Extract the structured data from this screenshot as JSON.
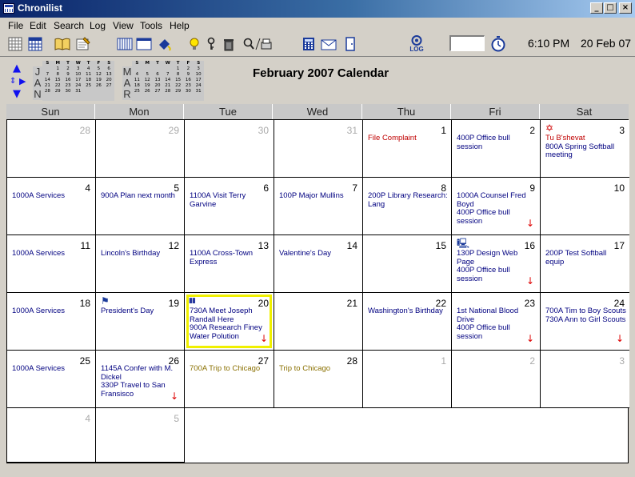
{
  "window": {
    "title": "Chronilist",
    "min_glyph": "_",
    "max_glyph": "□",
    "close_glyph": "×"
  },
  "menu": [
    "File",
    "Edit",
    "Search",
    "Log",
    "View",
    "Tools",
    "Help"
  ],
  "toolbar": {
    "time": "6:10 PM",
    "date": "20 Feb 07",
    "log_label": "LOG",
    "icons": [
      "year-view-icon",
      "month-view-icon",
      "book-icon",
      "notes-icon",
      "week-view-icon",
      "day-view-icon",
      "paint-icon",
      "idea-bulb-icon",
      "key-icon",
      "trash-icon",
      "find-print-icon",
      "calculator-icon",
      "mail-icon",
      "door-icon",
      "log-icon",
      "stopwatch-icon"
    ]
  },
  "nav": {
    "title": "February 2007 Calendar",
    "mini_prev": {
      "letters": [
        "J",
        "A",
        "N"
      ],
      "header": [
        "S",
        "M",
        "T",
        "W",
        "T",
        "F",
        "S"
      ],
      "days": [
        "",
        "1",
        "2",
        "3",
        "4",
        "5",
        "6",
        "7",
        "8",
        "9",
        "10",
        "11",
        "12",
        "13",
        "14",
        "15",
        "16",
        "17",
        "18",
        "19",
        "20",
        "21",
        "22",
        "23",
        "24",
        "25",
        "26",
        "27",
        "28",
        "29",
        "30",
        "31"
      ]
    },
    "mini_next": {
      "letters": [
        "M",
        "A",
        "R"
      ],
      "header": [
        "S",
        "M",
        "T",
        "W",
        "T",
        "F",
        "S"
      ],
      "days": [
        "",
        "",
        "",
        "",
        "1",
        "2",
        "3",
        "4",
        "5",
        "6",
        "7",
        "8",
        "9",
        "10",
        "11",
        "12",
        "13",
        "14",
        "15",
        "16",
        "17",
        "18",
        "19",
        "20",
        "21",
        "22",
        "23",
        "24",
        "25",
        "26",
        "27",
        "28",
        "29",
        "30",
        "31"
      ]
    }
  },
  "day_names": [
    "Sun",
    "Mon",
    "Tue",
    "Wed",
    "Thu",
    "Fri",
    "Sat"
  ],
  "weeks": [
    [
      {
        "num": "28",
        "other": true,
        "events": []
      },
      {
        "num": "29",
        "other": true,
        "events": []
      },
      {
        "num": "30",
        "other": true,
        "events": []
      },
      {
        "num": "31",
        "other": true,
        "events": []
      },
      {
        "num": "1",
        "events": [
          {
            "text": "File Complaint",
            "color": "red"
          }
        ]
      },
      {
        "num": "2",
        "events": [
          {
            "text": "400P Office bull session",
            "color": "navy"
          }
        ]
      },
      {
        "num": "3",
        "icon": "✡",
        "icon_name": "star-of-david-icon",
        "events": [
          {
            "text": "Tu B'shevat",
            "color": "red"
          },
          {
            "text": "800A Spring Softball meeting",
            "color": "navy"
          }
        ]
      }
    ],
    [
      {
        "num": "4",
        "events": [
          {
            "text": "1000A Services",
            "color": "navy"
          }
        ]
      },
      {
        "num": "5",
        "events": [
          {
            "text": "900A Plan next month",
            "color": "navy"
          }
        ]
      },
      {
        "num": "6",
        "events": [
          {
            "text": "1100A Visit Terry Garvine",
            "color": "navy"
          }
        ]
      },
      {
        "num": "7",
        "events": [
          {
            "text": "100P Major Mullins",
            "color": "navy"
          }
        ]
      },
      {
        "num": "8",
        "events": [
          {
            "text": "200P Library Research: Lang",
            "color": "navy"
          }
        ]
      },
      {
        "num": "9",
        "more": true,
        "events": [
          {
            "text": "1000A Counsel Fred Boyd",
            "color": "navy"
          },
          {
            "text": "400P Office bull session",
            "color": "navy"
          }
        ]
      },
      {
        "num": "10",
        "events": []
      }
    ],
    [
      {
        "num": "11",
        "events": [
          {
            "text": "1000A Services",
            "color": "navy"
          }
        ]
      },
      {
        "num": "12",
        "events": [
          {
            "text": "Lincoln's Birthday",
            "color": "navy"
          }
        ]
      },
      {
        "num": "13",
        "events": [
          {
            "text": "1100A Cross-Town Express",
            "color": "navy"
          }
        ]
      },
      {
        "num": "14",
        "events": [
          {
            "text": "Valentine's Day",
            "color": "navy"
          }
        ]
      },
      {
        "num": "15",
        "events": []
      },
      {
        "num": "16",
        "icon": "🖳",
        "icon_name": "computer-icon",
        "more": true,
        "events": [
          {
            "text": "130P Design Web Page",
            "color": "navy"
          },
          {
            "text": "400P Office bull session",
            "color": "navy"
          }
        ]
      },
      {
        "num": "17",
        "events": [
          {
            "text": "200P Test Softball equip",
            "color": "navy"
          }
        ]
      }
    ],
    [
      {
        "num": "18",
        "events": [
          {
            "text": "1000A Services",
            "color": "navy"
          }
        ]
      },
      {
        "num": "19",
        "icon": "⚑",
        "icon_name": "flag-icon",
        "events": [
          {
            "text": "President's Day",
            "color": "navy"
          }
        ]
      },
      {
        "num": "20",
        "icon": "▮▮",
        "icon_name": "birthday-candles-icon",
        "today": true,
        "more": true,
        "events": [
          {
            "text": "730A Meet Joseph Randall Here",
            "color": "navy"
          },
          {
            "text": "900A Research Finey Water Polution",
            "color": "navy"
          }
        ]
      },
      {
        "num": "21",
        "events": []
      },
      {
        "num": "22",
        "events": [
          {
            "text": "Washington's Birthday",
            "color": "navy"
          }
        ]
      },
      {
        "num": "23",
        "more": true,
        "events": [
          {
            "text": "1st National Blood Drive",
            "color": "navy"
          },
          {
            "text": "400P Office bull session",
            "color": "navy"
          }
        ]
      },
      {
        "num": "24",
        "more": true,
        "events": [
          {
            "text": "700A Tim to Boy Scouts",
            "color": "navy"
          },
          {
            "text": "730A Ann to Girl Scouts",
            "color": "navy"
          }
        ]
      }
    ],
    [
      {
        "num": "25",
        "events": [
          {
            "text": "1000A Services",
            "color": "navy"
          }
        ]
      },
      {
        "num": "26",
        "more": true,
        "events": [
          {
            "text": "1145A Confer with M. Dickel",
            "color": "navy"
          },
          {
            "text": "330P Travel to San Fransisco",
            "color": "navy"
          }
        ]
      },
      {
        "num": "27",
        "events": [
          {
            "text": "700A Trip to Chicago",
            "color": "olive"
          }
        ]
      },
      {
        "num": "28",
        "events": [
          {
            "text": "Trip to Chicago",
            "color": "olive"
          }
        ]
      },
      {
        "num": "1",
        "other": true,
        "events": []
      },
      {
        "num": "2",
        "other": true,
        "events": []
      },
      {
        "num": "3",
        "other": true,
        "events": []
      }
    ],
    [
      {
        "num": "4",
        "other": true,
        "events": []
      },
      {
        "num": "5",
        "other": true,
        "events": []
      }
    ]
  ],
  "more_glyph": "↓"
}
